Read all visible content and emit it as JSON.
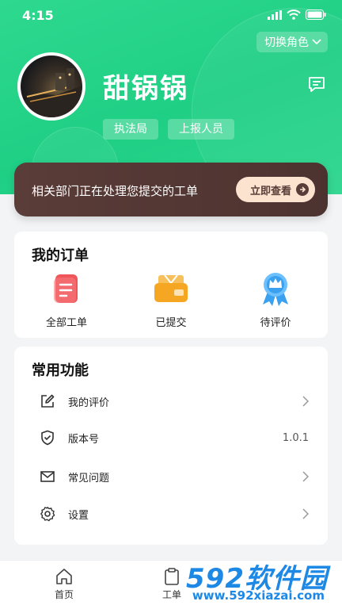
{
  "status_bar": {
    "time": "4:15"
  },
  "header": {
    "role_switch_label": "切换角色",
    "user_name": "甜锅锅",
    "tags": [
      "执法局",
      "上报人员"
    ]
  },
  "banner": {
    "text": "相关部门正在处理您提交的工单",
    "button_label": "立即查看"
  },
  "orders": {
    "title": "我的订单",
    "items": [
      {
        "label": "全部工单",
        "icon": "document-icon"
      },
      {
        "label": "已提交",
        "icon": "wallet-icon"
      },
      {
        "label": "待评价",
        "icon": "badge-icon"
      }
    ]
  },
  "functions": {
    "title": "常用功能",
    "items": [
      {
        "label": "我的评价",
        "icon": "edit-icon",
        "value": ""
      },
      {
        "label": "版本号",
        "icon": "shield-icon",
        "value": "1.0.1"
      },
      {
        "label": "常见问题",
        "icon": "mail-icon",
        "value": ""
      },
      {
        "label": "设置",
        "icon": "gear-icon",
        "value": ""
      }
    ]
  },
  "tabbar": {
    "tabs": [
      {
        "label": "首页",
        "icon": "home-icon"
      },
      {
        "label": "工单",
        "icon": "clipboard-icon"
      }
    ]
  },
  "watermark": {
    "brand": "592软件园",
    "url": "www.592xiazai.com"
  },
  "colors": {
    "header_green": "#1fcf84",
    "banner_brown": "#5a3c38",
    "banner_button": "#fbe3cf",
    "order_red": "#f0555a",
    "order_orange": "#f5a623",
    "badge_blue": "#3aa0f0",
    "watermark_blue": "#1e88e5"
  }
}
